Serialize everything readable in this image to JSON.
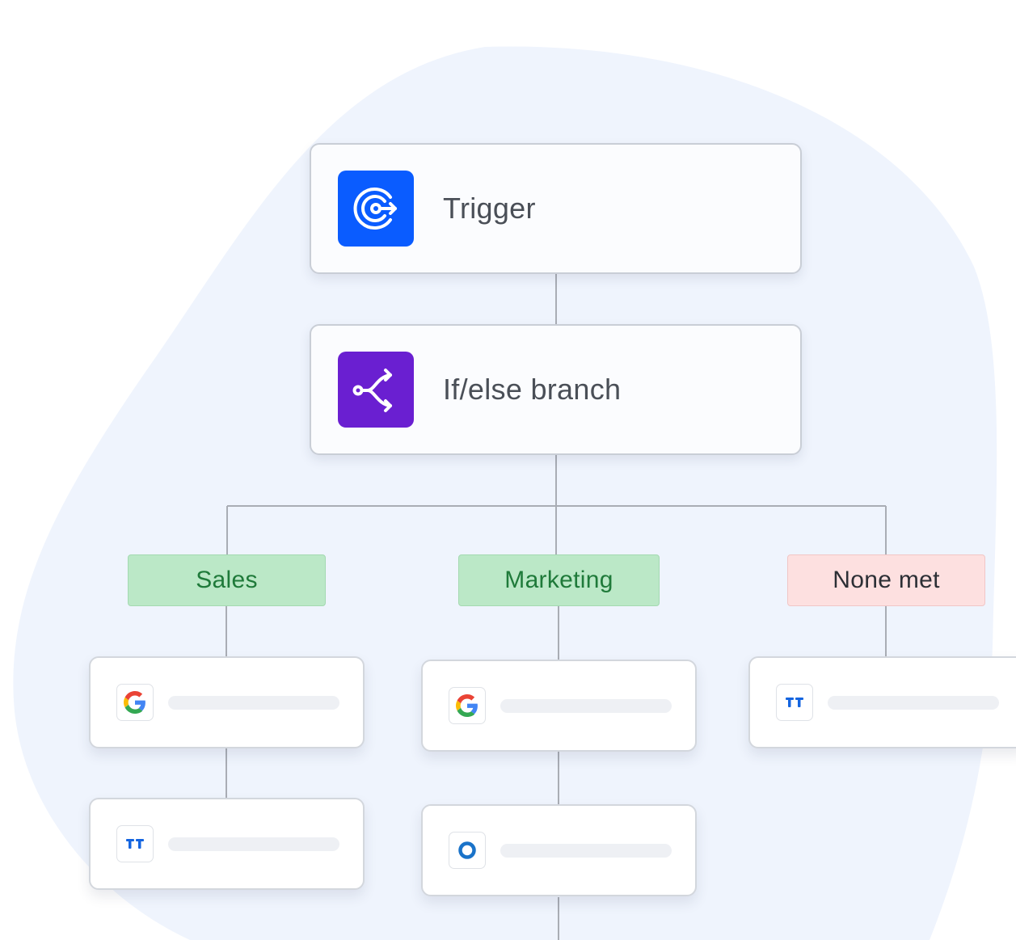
{
  "colors": {
    "blob_background": "#eff4fd",
    "connector": "#a9adb5",
    "trigger_icon_bg": "#0a5cff",
    "branch_icon_bg": "#6a1fd1",
    "tag_green_bg": "#bbe8c7",
    "tag_green_text": "#1f7a3a",
    "tag_red_bg": "#fde0e0",
    "tag_red_text": "#2c2f35"
  },
  "nodes": [
    {
      "label": "Trigger",
      "icon": "trigger-target-arrow-icon"
    },
    {
      "label": "If/else branch",
      "icon": "branch-split-icon"
    }
  ],
  "branches": [
    {
      "label": "Sales",
      "status": "matched",
      "steps": [
        {
          "app": "google-icon"
        },
        {
          "app": "talkdesk-icon"
        }
      ]
    },
    {
      "label": "Marketing",
      "status": "matched",
      "steps": [
        {
          "app": "google-icon"
        },
        {
          "app": "outreach-ring-icon"
        }
      ]
    },
    {
      "label": "None met",
      "status": "unmatched",
      "steps": [
        {
          "app": "talkdesk-icon"
        }
      ]
    }
  ]
}
